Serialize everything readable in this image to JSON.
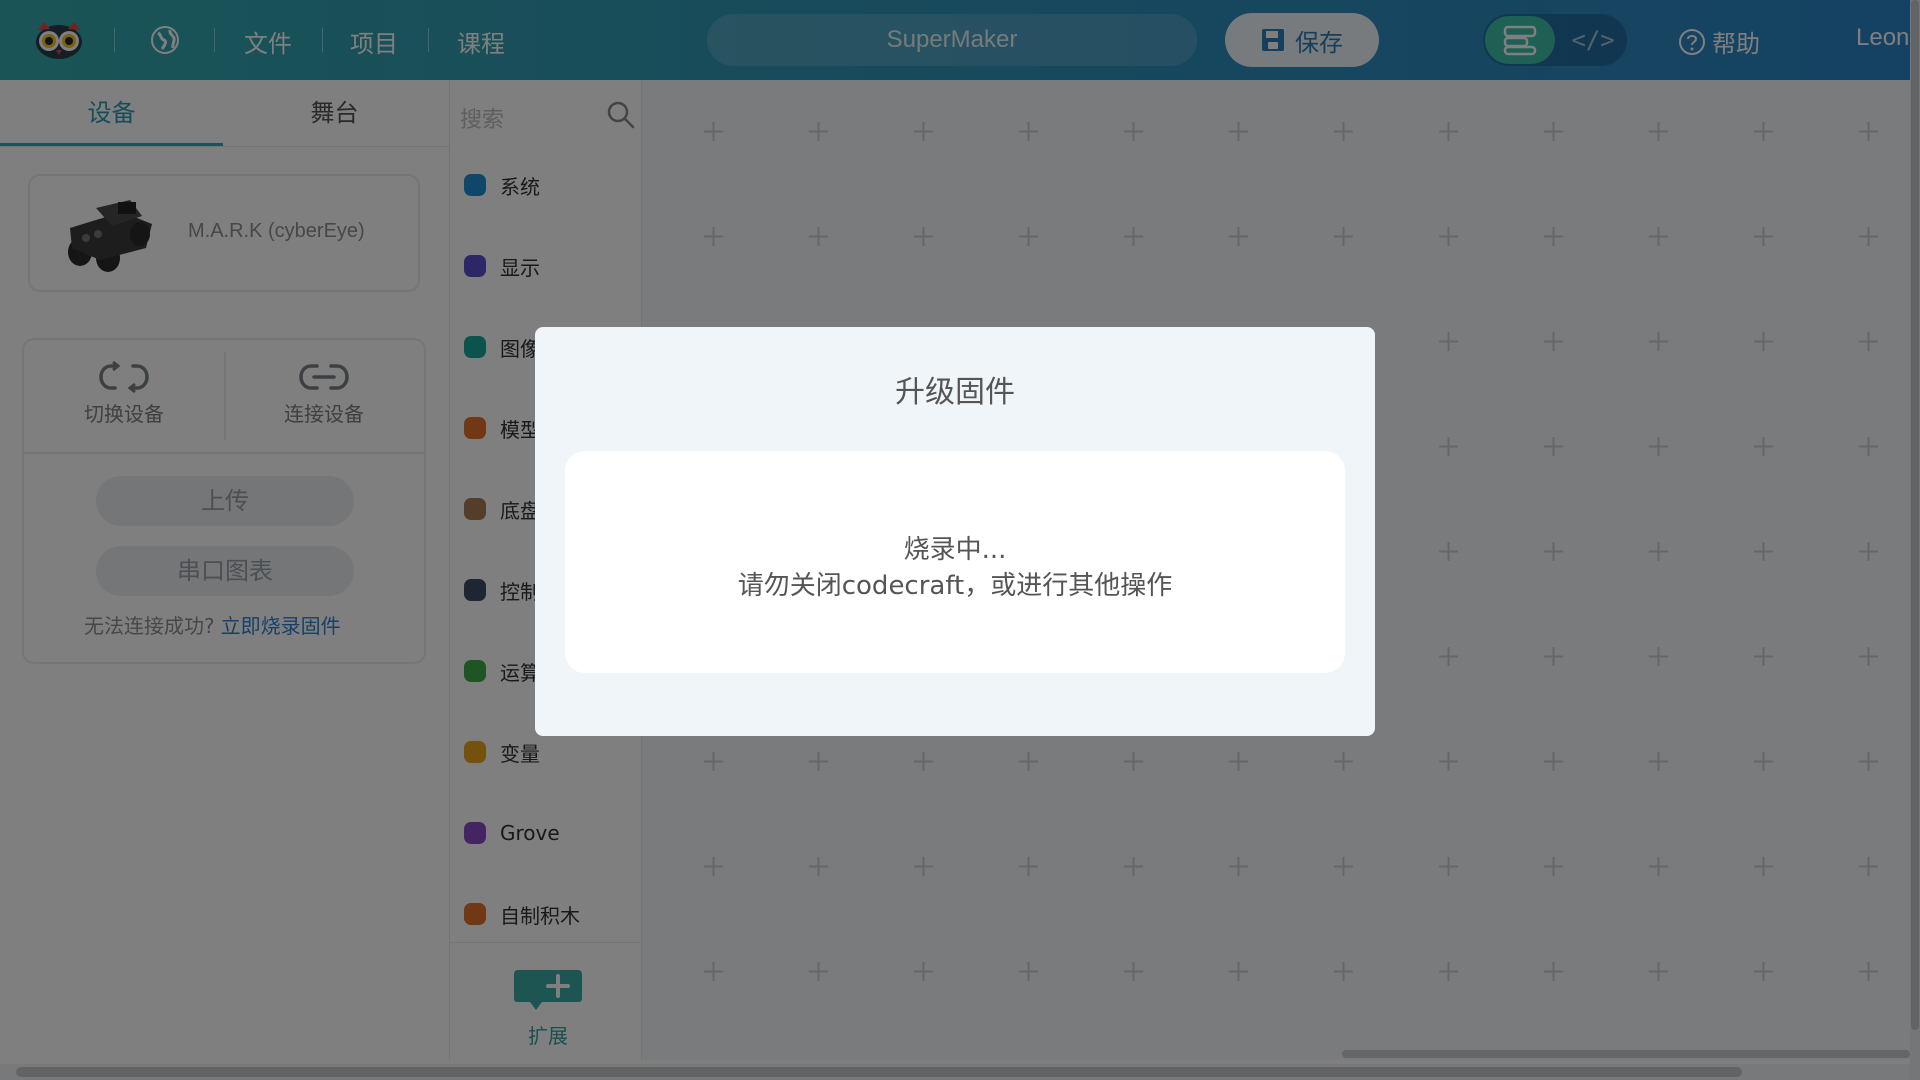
{
  "header": {
    "menu": [
      "文件",
      "项目",
      "课程"
    ],
    "project_name": "SuperMaker",
    "save_label": "保存",
    "code_toggle_label": "</>",
    "help_label": "帮助",
    "user_name": "Leon"
  },
  "left_panel": {
    "tabs": [
      "设备",
      "舞台"
    ],
    "active_tab": "设备",
    "device_name": "M.A.R.K (cyberEye)",
    "switch_device": "切换设备",
    "connect_device": "连接设备",
    "upload": "上传",
    "serial_chart": "串口图表",
    "cannot_connect": "无法连接成功?",
    "burn_firmware_link": "立即烧录固件"
  },
  "categories": {
    "search_placeholder": "搜索",
    "items": [
      {
        "label": "系统",
        "color": "#1f8fd6"
      },
      {
        "label": "显示",
        "color": "#5a4fcf"
      },
      {
        "label": "图像",
        "color": "#1aa79a"
      },
      {
        "label": "模型",
        "color": "#e0712a"
      },
      {
        "label": "底盘",
        "color": "#a87d55"
      },
      {
        "label": "控制",
        "color": "#3f4d66"
      },
      {
        "label": "运算",
        "color": "#3fa94a"
      },
      {
        "label": "变量",
        "color": "#e8a31c"
      },
      {
        "label": "Grove",
        "color": "#8b48c8"
      },
      {
        "label": "自制积木",
        "color": "#e0712a"
      }
    ],
    "extension_label": "扩展"
  },
  "modal": {
    "title": "升级固件",
    "line1": "烧录中...",
    "line2": "请勿关闭codecraft，或进行其他操作"
  },
  "colors": {
    "accent": "#3aa7b4",
    "link": "#2f7fd0",
    "header_start": "#34a9ac",
    "header_end": "#2a84c6"
  }
}
